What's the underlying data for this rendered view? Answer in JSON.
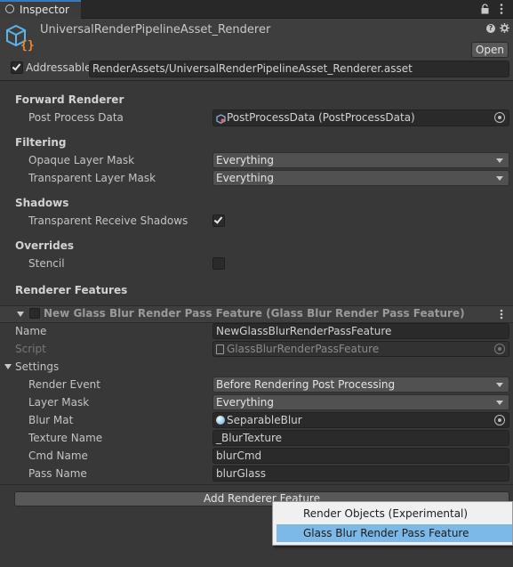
{
  "tab": {
    "title": "Inspector"
  },
  "header": {
    "asset_name": "UniversalRenderPipelineAsset_Renderer",
    "open_label": "Open"
  },
  "addressable": {
    "label": "Addressable",
    "checked": true,
    "path": "RenderAssets/UniversalRenderPipelineAsset_Renderer.asset"
  },
  "forward_renderer": {
    "title": "Forward Renderer",
    "post_process_label": "Post Process Data",
    "post_process_value": "PostProcessData (PostProcessData)"
  },
  "filtering": {
    "title": "Filtering",
    "opaque_label": "Opaque Layer Mask",
    "opaque_value": "Everything",
    "transparent_label": "Transparent Layer Mask",
    "transparent_value": "Everything"
  },
  "shadows": {
    "title": "Shadows",
    "receive_label": "Transparent Receive Shadows",
    "receive_checked": true
  },
  "overrides": {
    "title": "Overrides",
    "stencil_label": "Stencil",
    "stencil_checked": false
  },
  "renderer_features": {
    "title": "Renderer Features"
  },
  "feature": {
    "header": "New Glass Blur Render Pass Feature (Glass Blur Render Pass Feature)",
    "name_label": "Name",
    "name_value": "NewGlassBlurRenderPassFeature",
    "script_label": "Script",
    "script_value": "GlassBlurRenderPassFeature",
    "settings_label": "Settings",
    "render_event_label": "Render Event",
    "render_event_value": "Before Rendering Post Processing",
    "layer_mask_label": "Layer Mask",
    "layer_mask_value": "Everything",
    "blur_mat_label": "Blur Mat",
    "blur_mat_value": "SeparableBlur",
    "texture_name_label": "Texture Name",
    "texture_name_value": "_BlurTexture",
    "cmd_name_label": "Cmd Name",
    "cmd_name_value": "blurCmd",
    "pass_name_label": "Pass Name",
    "pass_name_value": "blurGlass"
  },
  "add_feature_button": "Add Renderer Feature",
  "popup_menu": {
    "items": [
      "Render Objects (Experimental)",
      "Glass Blur Render Pass Feature"
    ],
    "highlighted_index": 1
  },
  "colors": {
    "background": "#383838",
    "highlight": "#7db9e8",
    "menu_bg": "#f0f0f0"
  }
}
